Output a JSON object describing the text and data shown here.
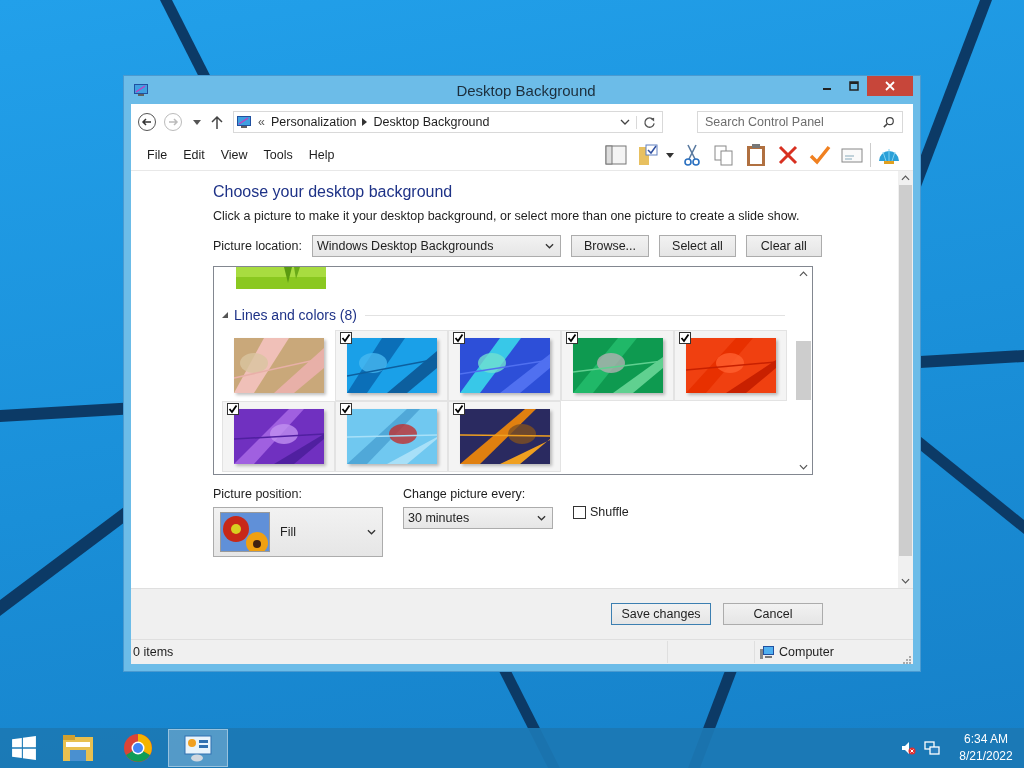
{
  "window": {
    "title": "Desktop Background"
  },
  "address_bar": {
    "overflow": "«",
    "path": [
      "Personalization",
      "Desktop Background"
    ]
  },
  "search": {
    "placeholder": "Search Control Panel"
  },
  "menu": [
    "File",
    "Edit",
    "View",
    "Tools",
    "Help"
  ],
  "heading": "Choose your desktop background",
  "description": "Click a picture to make it your desktop background, or select more than one picture to create a slide show.",
  "picture_location": {
    "label": "Picture location:",
    "value": "Windows Desktop Backgrounds"
  },
  "location_buttons": [
    "Browse...",
    "Select all",
    "Clear all"
  ],
  "group": {
    "title": "Lines and colors (8)",
    "expanded": true,
    "pictures": [
      {
        "kind": "picture",
        "checked": false
      },
      {
        "kind": "picture",
        "checked": true
      },
      {
        "kind": "picture",
        "checked": true
      },
      {
        "kind": "picture",
        "checked": true
      },
      {
        "kind": "picture",
        "checked": true
      },
      {
        "kind": "picture",
        "checked": true
      },
      {
        "kind": "picture",
        "checked": true
      },
      {
        "kind": "picture",
        "checked": true
      }
    ]
  },
  "picture_position": {
    "label": "Picture position:",
    "value": "Fill"
  },
  "interval": {
    "label": "Change picture every:",
    "value": "30 minutes"
  },
  "shuffle": {
    "label": "Shuffle",
    "checked": false
  },
  "dialog_buttons": [
    {
      "label": "Save changes",
      "default": true
    },
    {
      "label": "Cancel",
      "default": false
    }
  ],
  "status_bar": {
    "count": "0 items",
    "location": "Computer"
  },
  "taskbar": {
    "apps": [
      {
        "kind": "files",
        "active": false
      },
      {
        "kind": "browser",
        "active": false
      },
      {
        "kind": "control-panel",
        "active": true
      }
    ],
    "time": "6:34 AM",
    "date": "8/21/2022"
  }
}
